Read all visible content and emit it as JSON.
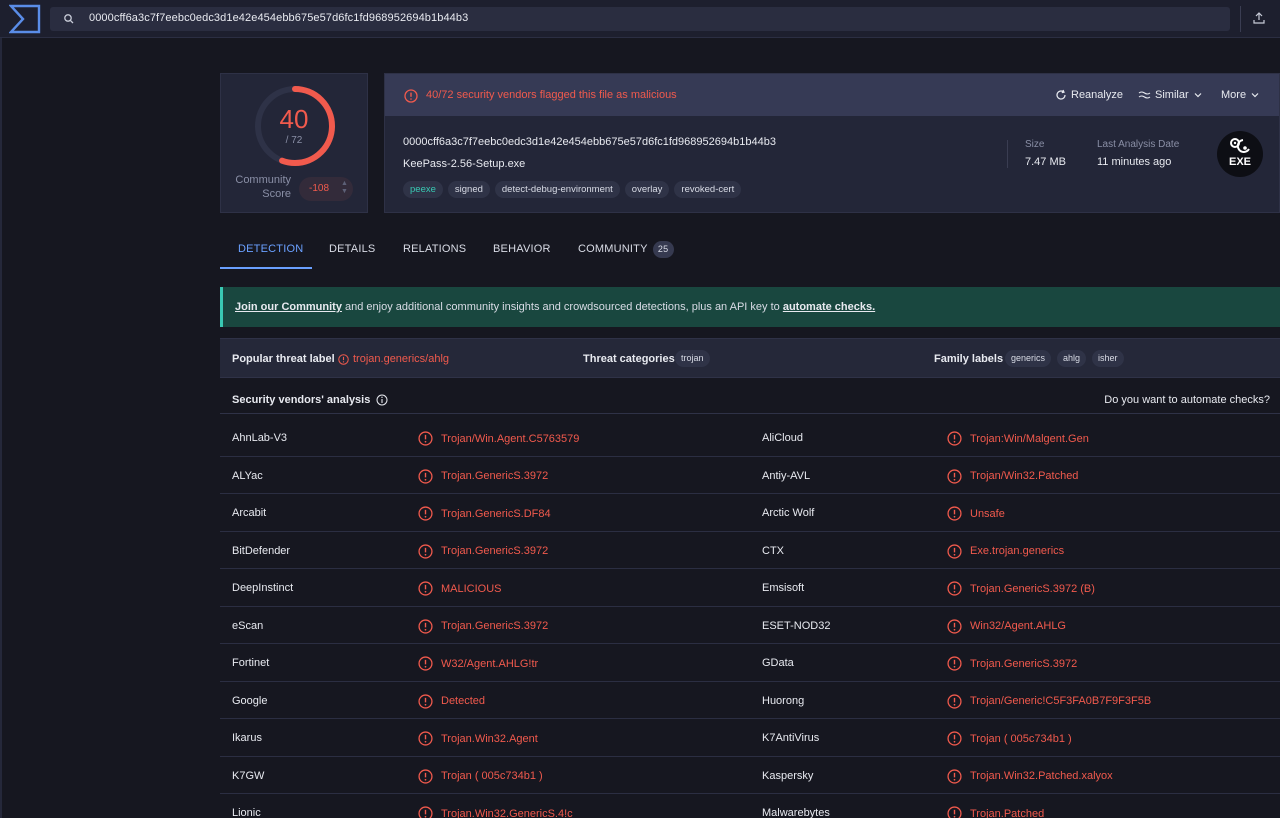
{
  "search": {
    "query": "0000cff6a3c7f7eebc0edc3d1e42e454ebb675e57d6fc1fd968952694b1b44b3"
  },
  "score": {
    "detections": "40",
    "total": "/ 72",
    "detection_fraction": 0.556,
    "community_label": "Community Score",
    "community_value": "-108"
  },
  "file": {
    "alert": "40/72 security vendors flagged this file as malicious",
    "reanalyze": "Reanalyze",
    "similar": "Similar",
    "more": "More",
    "hash": "0000cff6a3c7f7eebc0edc3d1e42e454ebb675e57d6fc1fd968952694b1b44b3",
    "name": "KeePass-2.56-Setup.exe",
    "tags": [
      "peexe",
      "signed",
      "detect-debug-environment",
      "overlay",
      "revoked-cert"
    ],
    "size_label": "Size",
    "size_value": "7.47 MB",
    "last_analysis_label": "Last Analysis Date",
    "last_analysis_value": "11 minutes ago",
    "type_badge": "EXE"
  },
  "tabs": [
    {
      "label": "DETECTION"
    },
    {
      "label": "DETAILS"
    },
    {
      "label": "RELATIONS"
    },
    {
      "label": "BEHAVIOR"
    },
    {
      "label": "COMMUNITY",
      "count": "25"
    }
  ],
  "banner": {
    "link1": "Join our Community",
    "middle": " and enjoy additional community insights and crowdsourced detections, plus an API key to ",
    "link2": "automate checks."
  },
  "threat": {
    "popular_label": "Popular threat label",
    "popular_value": "trojan.generics/ahlg",
    "categories_label": "Threat categories",
    "categories": [
      "trojan"
    ],
    "family_label": "Family labels",
    "families": [
      "generics",
      "ahlg",
      "isher"
    ]
  },
  "vendors_header": {
    "title": "Security vendors' analysis",
    "automate": "Do you want to automate checks?"
  },
  "vendors": [
    {
      "left": "AhnLab-V3",
      "left_result": "Trojan/Win.Agent.C5763579",
      "right": "AliCloud",
      "right_result": "Trojan:Win/Malgent.Gen"
    },
    {
      "left": "ALYac",
      "left_result": "Trojan.GenericS.3972",
      "right": "Antiy-AVL",
      "right_result": "Trojan/Win32.Patched"
    },
    {
      "left": "Arcabit",
      "left_result": "Trojan.GenericS.DF84",
      "right": "Arctic Wolf",
      "right_result": "Unsafe"
    },
    {
      "left": "BitDefender",
      "left_result": "Trojan.GenericS.3972",
      "right": "CTX",
      "right_result": "Exe.trojan.generics"
    },
    {
      "left": "DeepInstinct",
      "left_result": "MALICIOUS",
      "right": "Emsisoft",
      "right_result": "Trojan.GenericS.3972 (B)"
    },
    {
      "left": "eScan",
      "left_result": "Trojan.GenericS.3972",
      "right": "ESET-NOD32",
      "right_result": "Win32/Agent.AHLG"
    },
    {
      "left": "Fortinet",
      "left_result": "W32/Agent.AHLG!tr",
      "right": "GData",
      "right_result": "Trojan.GenericS.3972"
    },
    {
      "left": "Google",
      "left_result": "Detected",
      "right": "Huorong",
      "right_result": "Trojan/Generic!C5F3FA0B7F9F3F5B"
    },
    {
      "left": "Ikarus",
      "left_result": "Trojan.Win32.Agent",
      "right": "K7AntiVirus",
      "right_result": "Trojan ( 005c734b1 )"
    },
    {
      "left": "K7GW",
      "left_result": "Trojan ( 005c734b1 )",
      "right": "Kaspersky",
      "right_result": "Trojan.Win32.Patched.xalyox"
    },
    {
      "left": "Lionic",
      "left_result": "Trojan.Win32.GenericS.4!c",
      "right": "Malwarebytes",
      "right_result": "Trojan.Patched"
    }
  ],
  "colors": {
    "accent": "#6aa0ff",
    "danger": "#f15a4d",
    "teal": "#39c9b3",
    "background": "#161720"
  }
}
